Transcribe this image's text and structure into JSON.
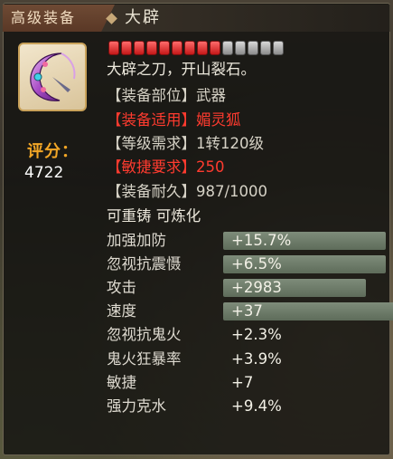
{
  "header": {
    "tab_label": "高级装备",
    "item_name": "大辟"
  },
  "item": {
    "icon": "crescent-moon-blade-icon",
    "score_label": "评分：",
    "score_value": "4722",
    "durability_pips": {
      "filled": 9,
      "total": 14
    }
  },
  "details": {
    "description": "大辟之刀，开山裂石。",
    "slot": "【装备部位】武器",
    "suit_label": "【装备适用】",
    "suit_value": "媚灵狐",
    "level": "【等级需求】1转120级",
    "agility_label": "【敏捷要求】",
    "agility_value": "250",
    "durability": "【装备耐久】987/1000",
    "flags": "可重铸 可炼化"
  },
  "stats": [
    {
      "name": "加强加防",
      "value": "+15.7%",
      "bar_fill": 0.75
    },
    {
      "name": "忽视抗震慑",
      "value": "+6.5%",
      "bar_fill": 0.75
    },
    {
      "name": "攻击",
      "value": "+2983",
      "bar_fill": 0.66
    },
    {
      "name": "速度",
      "value": "+37",
      "bar_fill": 0.8
    },
    {
      "name": "忽视抗鬼火",
      "value": "+2.3%",
      "bar_fill": 0
    },
    {
      "name": "鬼火狂暴率",
      "value": "+3.9%",
      "bar_fill": 0
    },
    {
      "name": "敏捷",
      "value": "+7",
      "bar_fill": 0
    },
    {
      "name": "强力克水",
      "value": "+9.4%",
      "bar_fill": 0
    }
  ],
  "colors": {
    "score": "#f2a626",
    "required": "#ff3b2f",
    "tab": "#6e4a34",
    "frame": "#c9a25a"
  }
}
